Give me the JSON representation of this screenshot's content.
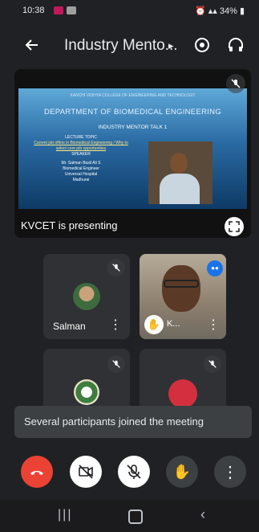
{
  "status_bar": {
    "time": "10:38",
    "battery": "34%"
  },
  "header": {
    "title": "Industry Mento...",
    "title_arrow": "▸"
  },
  "presentation": {
    "slide": {
      "institution": "KANCHI VIDHYA COLLEGE OF ENGINEERING AND TECHNOLOGY",
      "department": "DEPARTMENT OF BIOMEDICAL ENGINEERING",
      "talk": "INDUSTRY MENTOR TALK 1",
      "lecture_label": "LECTURE TOPIC",
      "topic": "Current job offers in Biomedical Engineering / Why to select core job opportunities",
      "speaker_label": "SPEAKER",
      "speaker_name": "Mr. Salman Basil Ali S",
      "speaker_role": "Biomedical Engineer",
      "speaker_org": "Universal Hospital",
      "speaker_city": "Madhurai"
    },
    "label": "KVCET is presenting"
  },
  "participants": [
    {
      "name": "Salman"
    },
    {
      "name": "K..."
    },
    {
      "name": ""
    },
    {
      "name": ""
    }
  ],
  "toast": {
    "message": "Several participants joined the meeting"
  },
  "colors": {
    "background": "#202124",
    "end_call": "#ea4335",
    "speaking": "#1a73e8",
    "toast": "#3c4043"
  }
}
